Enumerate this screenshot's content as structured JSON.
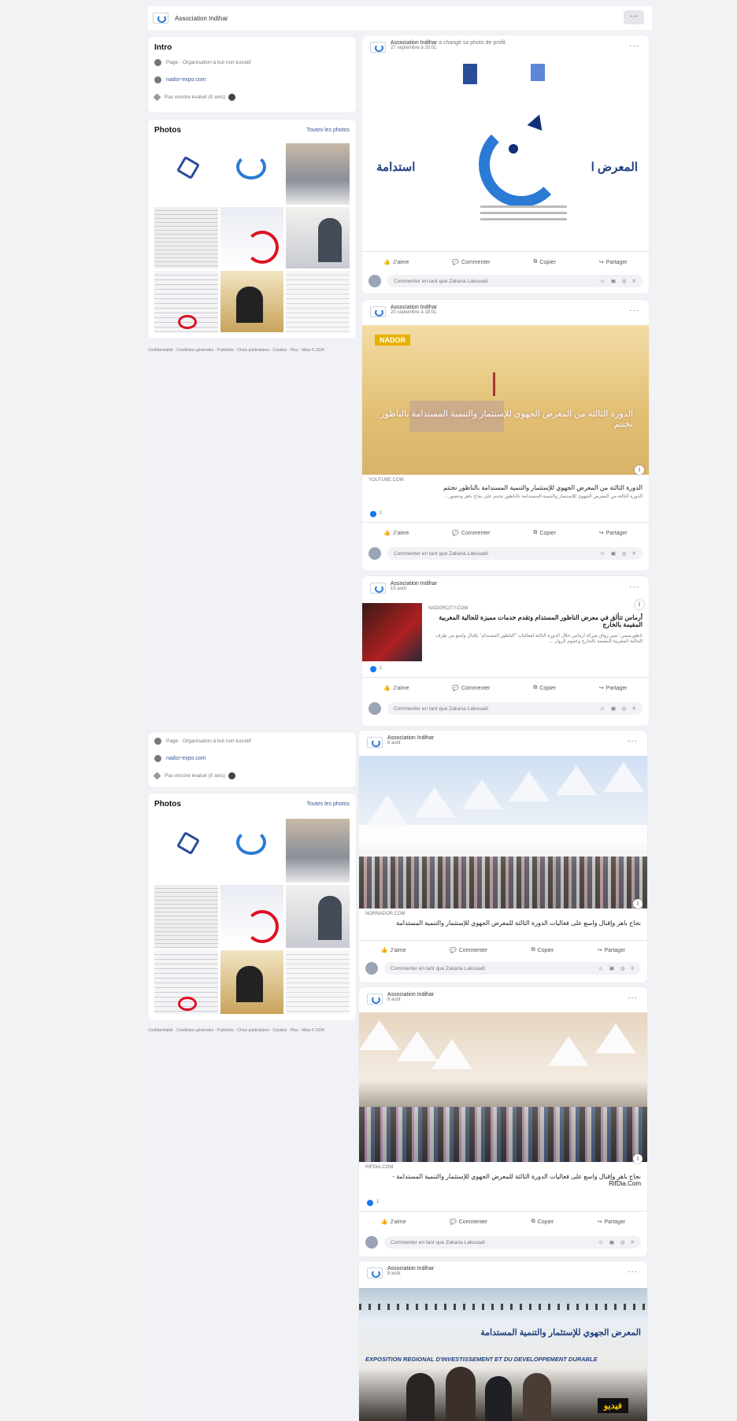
{
  "header": {
    "page_name": "Association Indihar",
    "more": "···"
  },
  "intro": {
    "title": "Intro",
    "category": "Page · Organisation à but non lucratif",
    "website": "nador-expo.com",
    "rating": "Pas encore évalué (0 avis)"
  },
  "photos": {
    "title": "Photos",
    "see_all": "Toutes les photos"
  },
  "footer": {
    "links": "Confidentialité · Conditions générales · Publicités · Choix publicitaires · Cookies · Plus · Meta © 2024"
  },
  "actions": {
    "like": "J’aime",
    "comment": "Commenter",
    "copy": "Copier",
    "share": "Partager"
  },
  "comment_placeholder": "Commenter en tant que Zakaria Lakouadi",
  "posts": [
    {
      "author": "Association Indihar",
      "action": "a changé sa photo de profil.",
      "date": "27 septembre à 20:01"
    },
    {
      "author": "Association Indihar",
      "date": "20 septembre à 18:01",
      "source": "YOUTUBE.COM",
      "overlay": "NADOR",
      "headline": "الدورة الثالثة من المعرض الجهوي للإستثمار والتنمية المستدامة بالناظور تختتم",
      "excerpt": "الدورة الثالثة من المعرض الجهوي للإستثمار والتنمية المستدامة بالناظور تختتم على نجاح باهر وحضور ...",
      "reactions": "1"
    },
    {
      "author": "Association Indihar",
      "date": "15 août",
      "source": "NADORCITY.COM",
      "headline": "أرماس تتألق في معرض الناظور المستدام وتقدم خدمات مميزة للجالية المغربية المقيمة بالخارج",
      "excerpt": "ناظورسيتي: تميز رواق شركة أرماس خلال الدورة الثالثة لفعاليات \"الناظور المستدام\" بإقبال واسع من طرف الجالية المغربية المقيمة بالخارج وعموم الزوار ...",
      "reactions": "1"
    },
    {
      "author": "Association Indihar",
      "date": "8 août",
      "source": "NORNADOR.COM",
      "headline": "نجاح باهر وإقبال واسع على فعاليات الدورة الثالثة للمعرض الجهوي للإستثمار والتنمية المستدامة"
    },
    {
      "author": "Association Indihar",
      "date": "8 août",
      "source": "RIFDIA.COM",
      "headline": "نجاح باهر وإقبال واسع على فعاليات الدورة الثالثة للمعرض الجهوي للإستثمار والتنمية المستدامة - RifDia.Com",
      "reactions": "1"
    },
    {
      "author": "Association Indihar",
      "date": "8 août",
      "banner_ar": "المعرض الجهوي للإستثمار والتنمية المستدامة",
      "banner_fr": "EXPOSITION REGIONAL D'INVESTISSEMENT ET DU DEVELOPPEMENT DURABLE",
      "video_badge": "فيديو"
    }
  ],
  "profile_pic": {
    "ar_left": "استدامة",
    "ar_right": "المعرض ا"
  },
  "colors": {
    "brand_blue": "#1877f2",
    "logo_blue": "#2b7bd4",
    "sand": "#e3c27a"
  }
}
